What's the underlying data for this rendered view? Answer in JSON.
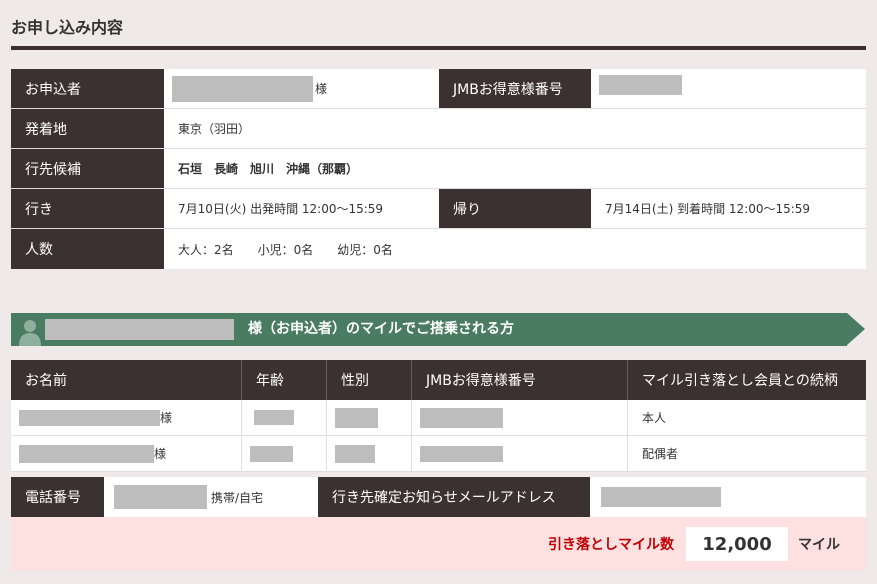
{
  "page": {
    "title": "お申し込み内容"
  },
  "application": {
    "applicant_label": "お申込者",
    "applicant_suffix": "様",
    "jmb_label": "JMBお得意様番号",
    "origin_label": "発着地",
    "origin_value": "東京（羽田）",
    "destinations_label": "行先候補",
    "destinations_value": "石垣　長崎　旭川　沖縄（那覇）",
    "outbound_label": "行き",
    "outbound_value": "7月10日(火) 出発時間 12:00～15:59",
    "return_label": "帰り",
    "return_value": "7月14日(土) 到着時間 12:00～15:59",
    "pax_label": "人数",
    "pax_value": "大人：2名　　小児：0名　　幼児：0名"
  },
  "banner": {
    "text": "様（お申込者）のマイルでご搭乗される方",
    "icon": "person-icon"
  },
  "passengers": {
    "headers": [
      "お名前",
      "年齢",
      "性別",
      "JMBお得意様番号",
      "マイル引き落とし会員との続柄"
    ],
    "rows": [
      {
        "name_suffix": "様",
        "relation": "本人"
      },
      {
        "name_suffix": "様",
        "relation": "配偶者"
      }
    ]
  },
  "contact": {
    "phone_label": "電話番号",
    "phone_type": "携帯/自宅",
    "email_label": "行き先確定お知らせメールアドレス"
  },
  "miles": {
    "label": "引き落としマイル数",
    "value": "12,000",
    "unit": "マイル"
  },
  "colors": {
    "header_bg": "#3c3131",
    "banner_bg": "#4a7c62",
    "miles_bg": "#fde0e0",
    "miles_label": "#c00000"
  }
}
